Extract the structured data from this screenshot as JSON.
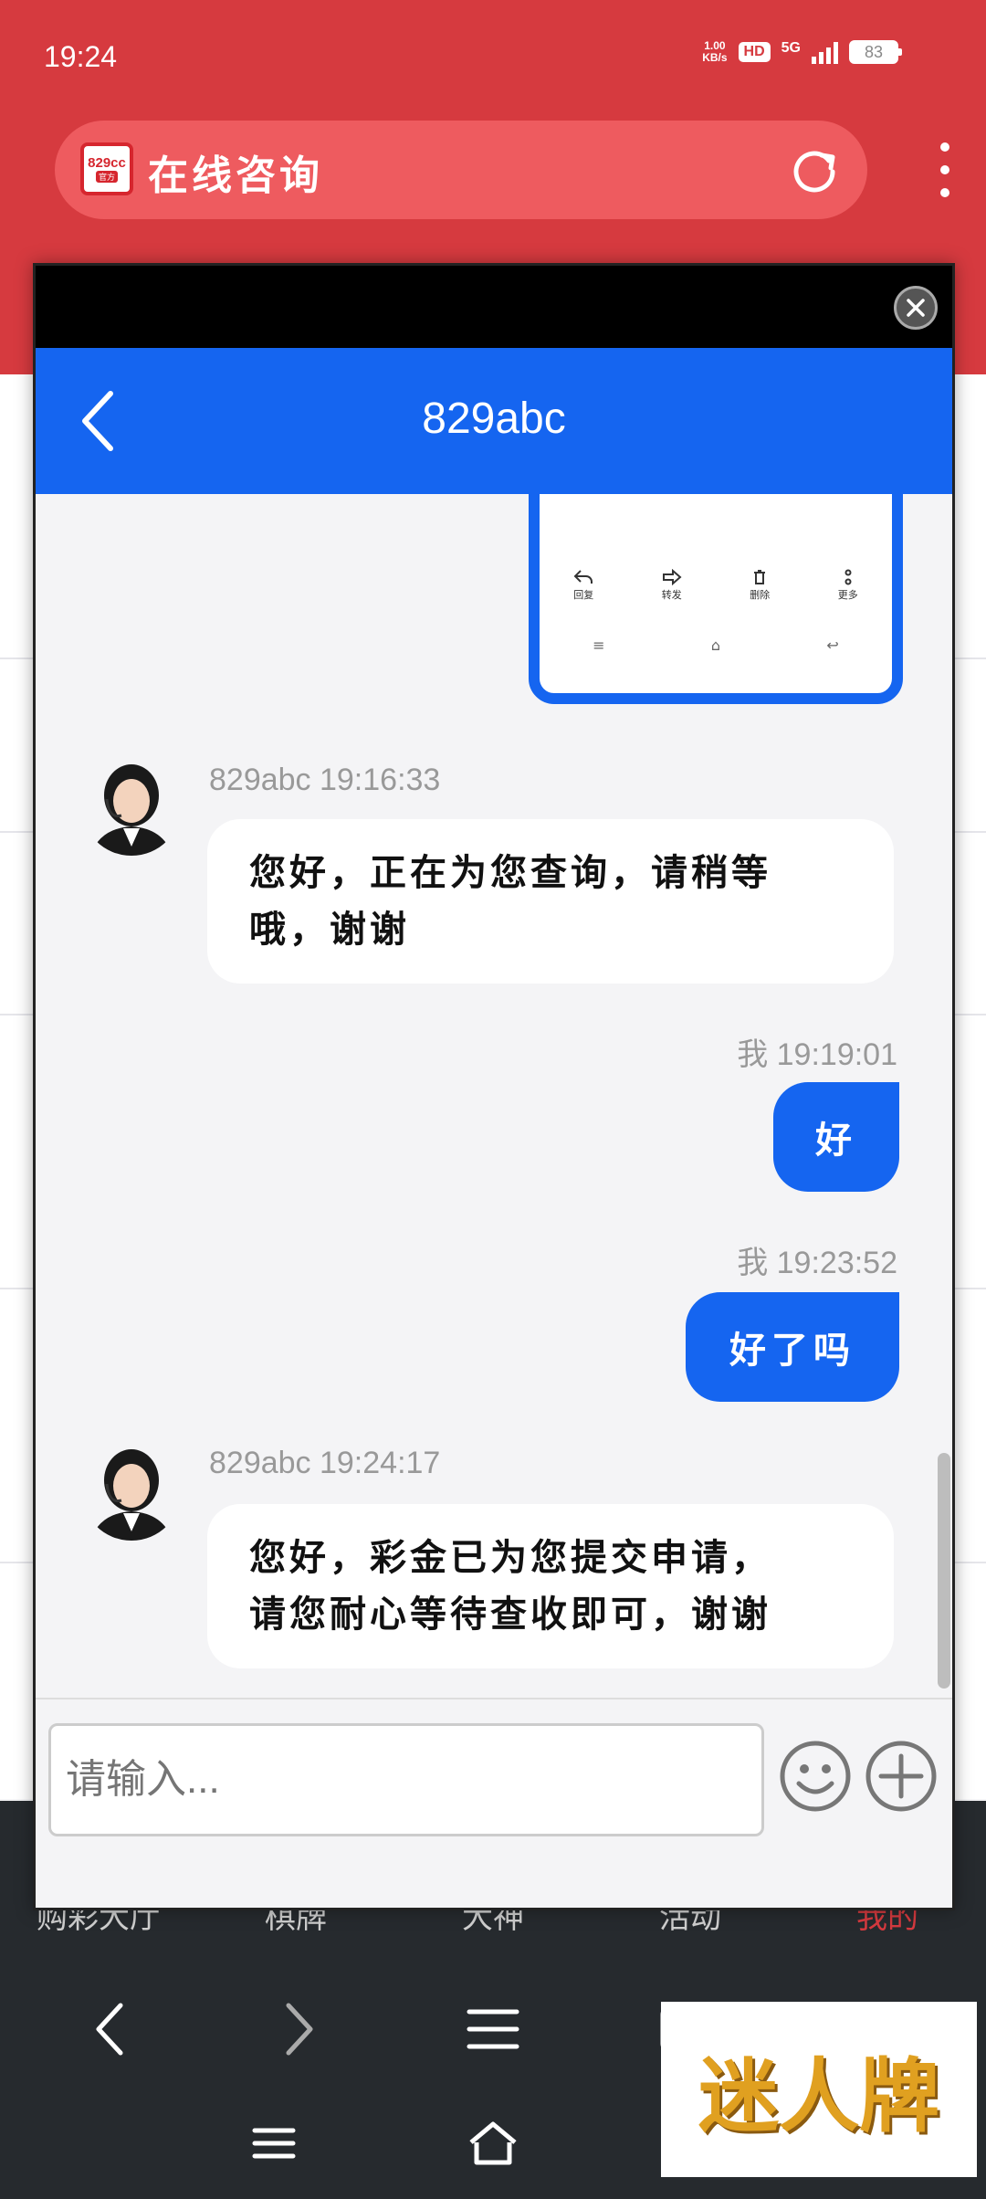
{
  "status_bar": {
    "time": "19:24",
    "net_speed_value": "1.00",
    "net_speed_unit": "KB/s",
    "hd": "HD",
    "network": "5G",
    "battery": "83"
  },
  "browser": {
    "title": "在线咨询",
    "logo_text": "829cc",
    "logo_sub": "官方"
  },
  "chat": {
    "title": "829abc",
    "image_preview": {
      "actions": [
        "回复",
        "转发",
        "删除",
        "更多"
      ]
    },
    "messages": [
      {
        "sender": "829abc",
        "time": "829abc 19:16:33",
        "text_line1": "您好，正在为您查询，请稍等",
        "text_line2": "哦，谢谢"
      },
      {
        "sender": "我",
        "time": "我 19:19:01",
        "text": "好"
      },
      {
        "sender": "我",
        "time": "我 19:23:52",
        "text": "好了吗"
      },
      {
        "sender": "829abc",
        "time": "829abc 19:24:17",
        "text_line1": "您好，彩金已为您提交申请，",
        "text_line2": "请您耐心等待查收即可，谢谢"
      }
    ],
    "input_placeholder": "请输入..."
  },
  "bottom_tabs": [
    "购彩大厅",
    "棋牌",
    "大神",
    "活动",
    "我的"
  ],
  "watermark": "迷人牌",
  "colors": {
    "brand_red": "#d63a3f",
    "chat_blue": "#1565f0",
    "bottom_bg": "#262a2e"
  }
}
